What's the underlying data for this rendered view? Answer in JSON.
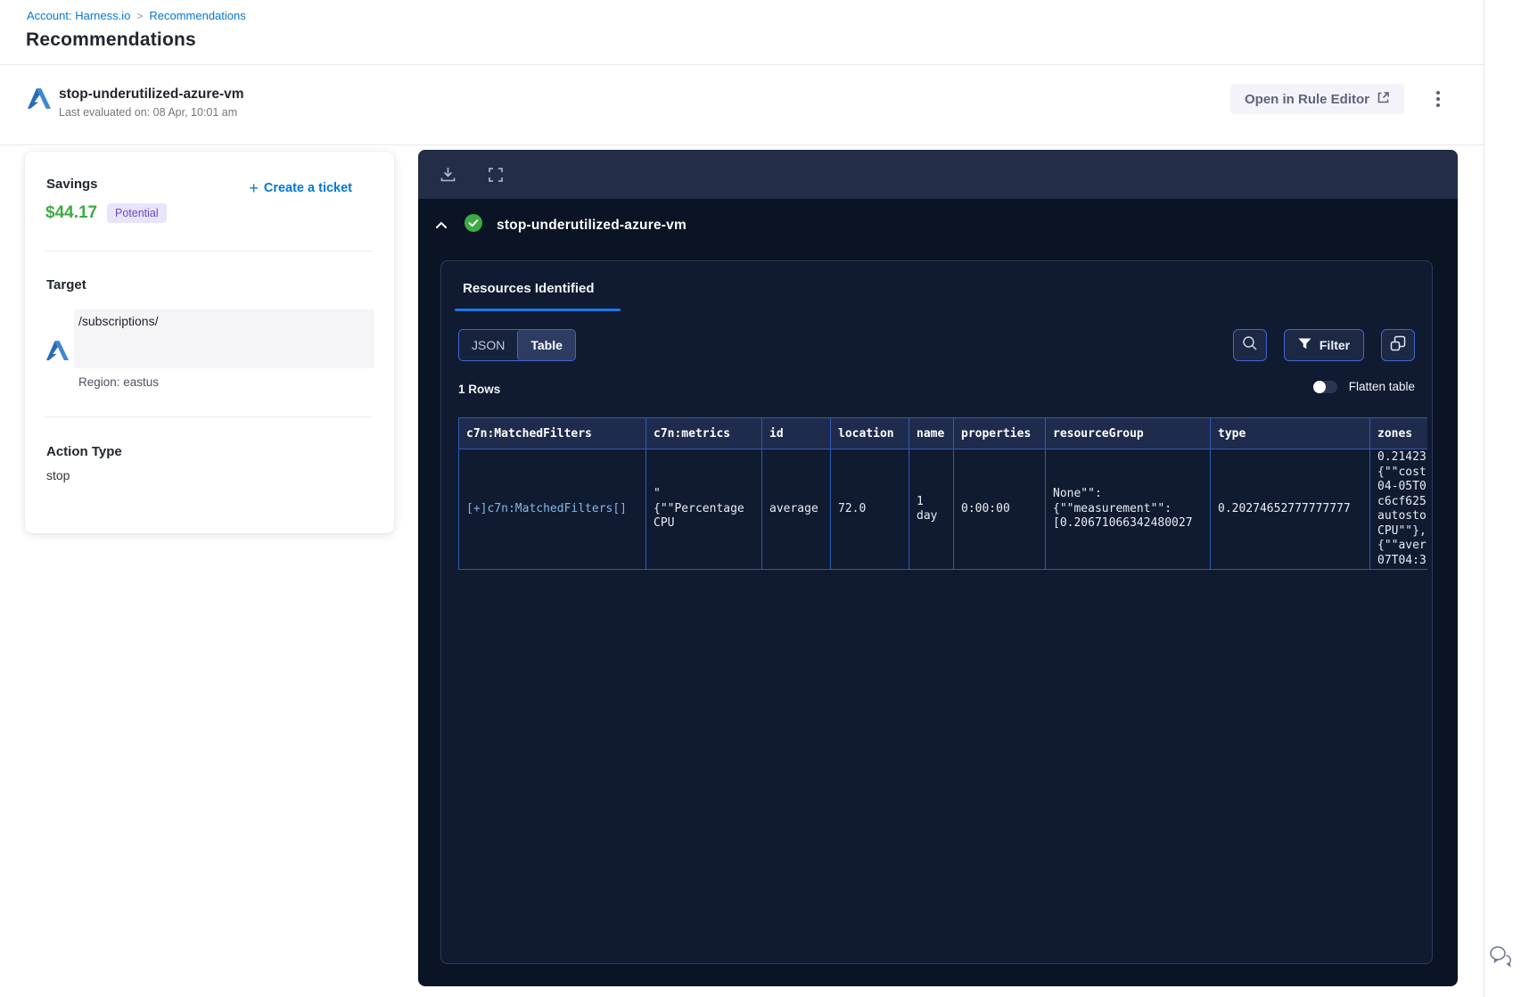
{
  "breadcrumb": {
    "account": "Account: Harness.io",
    "separator": ">",
    "page": "Recommendations"
  },
  "page_title": "Recommendations",
  "recommendation_header": {
    "name": "stop-underutilized-azure-vm",
    "last_evaluated": "Last evaluated on: 08 Apr, 10:01 am",
    "open_rule_editor_label": "Open in Rule Editor"
  },
  "details_card": {
    "savings_label": "Savings",
    "savings_amount": "$44.17",
    "savings_badge": "Potential",
    "create_ticket_label": "Create a ticket",
    "create_ticket_plus": "+",
    "target_label": "Target",
    "target_path": "/subscriptions/",
    "region": "Region: eastus",
    "action_type_label": "Action Type",
    "action_type_value": "stop"
  },
  "panel": {
    "title": "stop-underutilized-azure-vm",
    "tab_label": "Resources Identified",
    "view_toggle": {
      "json_label": "JSON",
      "table_label": "Table",
      "selected": "Table"
    },
    "filter_label": "Filter",
    "rows_count": "1 Rows",
    "flatten_label": "Flatten table",
    "table": {
      "columns": [
        "c7n:MatchedFilters",
        "c7n:metrics",
        "id",
        "location",
        "name",
        "properties",
        "resourceGroup",
        "type",
        "zones"
      ],
      "row": {
        "matched_filters": "[+]c7n:MatchedFilters[]",
        "metrics": "\"\n{\"\"Percentage\nCPU",
        "id": "average",
        "location": "72.0",
        "name": "1\nday",
        "properties": "0:00:00",
        "resource_group": "None\"\":\n{\"\"measurement\"\":\n[0.20671066342480027",
        "type": "0.20274652777777777",
        "zones": "0.21423\n{\"\"cost\n04-05T0\nc6cf625\nautosto\nCPU\"\"},\n{\"\"aver\n07T04:3"
      }
    }
  },
  "colors": {
    "link_blue": "#0278d5",
    "savings_green": "#3dab44",
    "badge_bg": "#e8e4fb",
    "badge_text": "#6d47c9",
    "panel_bg": "#0a1425",
    "panel_toolbar_bg": "#232d47",
    "inner_panel_bg": "#101a30",
    "grid_border_blue": "#2d5cb3",
    "tab_underline_blue": "#1f78e8",
    "success_green": "#3dab44"
  }
}
